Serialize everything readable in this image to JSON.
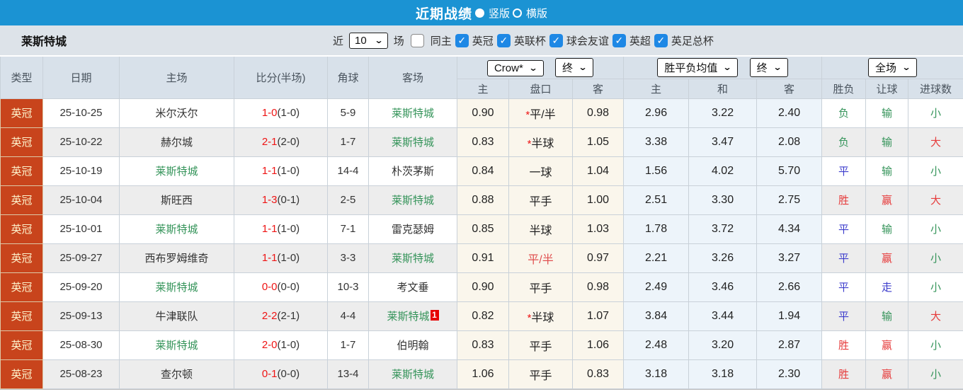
{
  "topbar": {
    "title": "近期战绩",
    "radio_vertical": "竖版",
    "radio_horizontal": "横版",
    "bar_color": "#1b93d3"
  },
  "filter": {
    "team": "莱斯特城",
    "near_label": "近",
    "count_value": "10",
    "games_label": "场",
    "same_home_label": "同主",
    "leagues": [
      {
        "label": "英冠",
        "checked": true
      },
      {
        "label": "英联杯",
        "checked": true
      },
      {
        "label": "球会友谊",
        "checked": true
      },
      {
        "label": "英超",
        "checked": true
      },
      {
        "label": "英足总杯",
        "checked": true
      }
    ]
  },
  "table": {
    "headers": {
      "type": "类型",
      "date": "日期",
      "home": "主场",
      "score": "比分(半场)",
      "corner": "角球",
      "away": "客场",
      "dropdown_bookmaker": "Crow*",
      "dropdown_final1": "终",
      "dropdown_avg": "胜平负均值",
      "dropdown_final2": "终",
      "dropdown_fullmatch": "全场",
      "sub": [
        "主",
        "盘口",
        "客",
        "主",
        "和",
        "客",
        "胜负",
        "让球",
        "进球数"
      ]
    },
    "rows": [
      {
        "league": "英冠",
        "date": "25-10-25",
        "home": "米尔沃尔",
        "home_green": false,
        "score_ft": "1-0",
        "score_ht": "(1-0)",
        "corner": "5-9",
        "away": "莱斯特城",
        "away_green": true,
        "away_badge": "",
        "home_odds": "0.90",
        "handicap": {
          "star": true,
          "text": "平/半",
          "red": false
        },
        "away_odds": "0.98",
        "europe": [
          "2.96",
          "3.22",
          "2.40"
        ],
        "results": [
          {
            "text": "负",
            "color": "green"
          },
          {
            "text": "输",
            "color": "green"
          },
          {
            "text": "小",
            "color": "green"
          }
        ]
      },
      {
        "league": "英冠",
        "date": "25-10-22",
        "home": "赫尔城",
        "home_green": false,
        "score_ft": "2-1",
        "score_ht": "(2-0)",
        "corner": "1-7",
        "away": "莱斯特城",
        "away_green": true,
        "away_badge": "",
        "home_odds": "0.83",
        "handicap": {
          "star": true,
          "text": "半球",
          "red": false
        },
        "away_odds": "1.05",
        "europe": [
          "3.38",
          "3.47",
          "2.08"
        ],
        "results": [
          {
            "text": "负",
            "color": "green"
          },
          {
            "text": "输",
            "color": "green"
          },
          {
            "text": "大",
            "color": "red"
          }
        ]
      },
      {
        "league": "英冠",
        "date": "25-10-19",
        "home": "莱斯特城",
        "home_green": true,
        "score_ft": "1-1",
        "score_ht": "(1-0)",
        "corner": "14-4",
        "away": "朴茨茅斯",
        "away_green": false,
        "away_badge": "",
        "home_odds": "0.84",
        "handicap": {
          "star": false,
          "text": "一球",
          "red": false
        },
        "away_odds": "1.04",
        "europe": [
          "1.56",
          "4.02",
          "5.70"
        ],
        "results": [
          {
            "text": "平",
            "color": "blue"
          },
          {
            "text": "输",
            "color": "green"
          },
          {
            "text": "小",
            "color": "green"
          }
        ]
      },
      {
        "league": "英冠",
        "date": "25-10-04",
        "home": "斯旺西",
        "home_green": false,
        "score_ft": "1-3",
        "score_ht": "(0-1)",
        "corner": "2-5",
        "away": "莱斯特城",
        "away_green": true,
        "away_badge": "",
        "home_odds": "0.88",
        "handicap": {
          "star": false,
          "text": "平手",
          "red": false
        },
        "away_odds": "1.00",
        "europe": [
          "2.51",
          "3.30",
          "2.75"
        ],
        "results": [
          {
            "text": "胜",
            "color": "red"
          },
          {
            "text": "赢",
            "color": "red"
          },
          {
            "text": "大",
            "color": "red"
          }
        ]
      },
      {
        "league": "英冠",
        "date": "25-10-01",
        "home": "莱斯特城",
        "home_green": true,
        "score_ft": "1-1",
        "score_ht": "(1-0)",
        "corner": "7-1",
        "away": "雷克瑟姆",
        "away_green": false,
        "away_badge": "",
        "home_odds": "0.85",
        "handicap": {
          "star": false,
          "text": "半球",
          "red": false
        },
        "away_odds": "1.03",
        "europe": [
          "1.78",
          "3.72",
          "4.34"
        ],
        "results": [
          {
            "text": "平",
            "color": "blue"
          },
          {
            "text": "输",
            "color": "green"
          },
          {
            "text": "小",
            "color": "green"
          }
        ]
      },
      {
        "league": "英冠",
        "date": "25-09-27",
        "home": "西布罗姆维奇",
        "home_green": false,
        "score_ft": "1-1",
        "score_ht": "(1-0)",
        "corner": "3-3",
        "away": "莱斯特城",
        "away_green": true,
        "away_badge": "",
        "home_odds": "0.91",
        "handicap": {
          "star": false,
          "text": "平/半",
          "red": true
        },
        "away_odds": "0.97",
        "europe": [
          "2.21",
          "3.26",
          "3.27"
        ],
        "results": [
          {
            "text": "平",
            "color": "blue"
          },
          {
            "text": "赢",
            "color": "red"
          },
          {
            "text": "小",
            "color": "green"
          }
        ]
      },
      {
        "league": "英冠",
        "date": "25-09-20",
        "home": "莱斯特城",
        "home_green": true,
        "score_ft": "0-0",
        "score_ht": "(0-0)",
        "corner": "10-3",
        "away": "考文垂",
        "away_green": false,
        "away_badge": "",
        "home_odds": "0.90",
        "handicap": {
          "star": false,
          "text": "平手",
          "red": false
        },
        "away_odds": "0.98",
        "europe": [
          "2.49",
          "3.46",
          "2.66"
        ],
        "results": [
          {
            "text": "平",
            "color": "blue"
          },
          {
            "text": "走",
            "color": "blue"
          },
          {
            "text": "小",
            "color": "green"
          }
        ]
      },
      {
        "league": "英冠",
        "date": "25-09-13",
        "home": "牛津联队",
        "home_green": false,
        "score_ft": "2-2",
        "score_ht": "(2-1)",
        "corner": "4-4",
        "away": "莱斯特城",
        "away_green": true,
        "away_badge": "1",
        "home_odds": "0.82",
        "handicap": {
          "star": true,
          "text": "半球",
          "red": false
        },
        "away_odds": "1.07",
        "europe": [
          "3.84",
          "3.44",
          "1.94"
        ],
        "results": [
          {
            "text": "平",
            "color": "blue"
          },
          {
            "text": "输",
            "color": "green"
          },
          {
            "text": "大",
            "color": "red"
          }
        ]
      },
      {
        "league": "英冠",
        "date": "25-08-30",
        "home": "莱斯特城",
        "home_green": true,
        "score_ft": "2-0",
        "score_ht": "(1-0)",
        "corner": "1-7",
        "away": "伯明翰",
        "away_green": false,
        "away_badge": "",
        "home_odds": "0.83",
        "handicap": {
          "star": false,
          "text": "平手",
          "red": false
        },
        "away_odds": "1.06",
        "europe": [
          "2.48",
          "3.20",
          "2.87"
        ],
        "results": [
          {
            "text": "胜",
            "color": "red"
          },
          {
            "text": "赢",
            "color": "red"
          },
          {
            "text": "小",
            "color": "green"
          }
        ]
      },
      {
        "league": "英冠",
        "date": "25-08-23",
        "home": "查尔顿",
        "home_green": false,
        "score_ft": "0-1",
        "score_ht": "(0-0)",
        "corner": "13-4",
        "away": "莱斯特城",
        "away_green": true,
        "away_badge": "",
        "home_odds": "1.06",
        "handicap": {
          "star": false,
          "text": "平手",
          "red": false
        },
        "away_odds": "0.83",
        "europe": [
          "3.18",
          "3.18",
          "2.30"
        ],
        "results": [
          {
            "text": "胜",
            "color": "red"
          },
          {
            "text": "赢",
            "color": "red"
          },
          {
            "text": "小",
            "color": "green"
          }
        ]
      }
    ]
  },
  "colors": {
    "topbar_blue": "#1b93d3",
    "league_badge_bg": "#c8441c",
    "leicester_green": "#35945a",
    "score_red": "#ee1414",
    "result_red": "#e63c3c",
    "result_blue": "#3c3ccc",
    "handicap_col_bg": "#faf6ec",
    "europe_col_bg": "#edf4fa"
  }
}
